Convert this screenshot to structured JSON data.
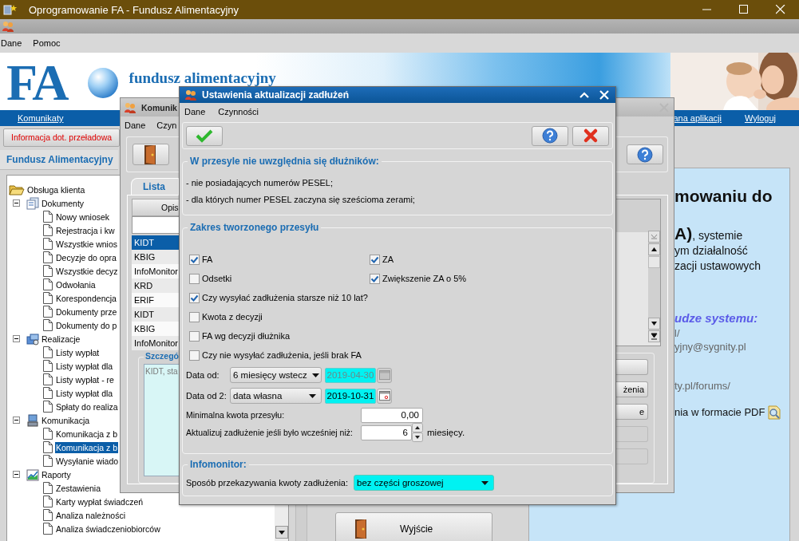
{
  "app": {
    "title": "Oprogramowanie FA - Fundusz Alimentacyjny",
    "menu": [
      {
        "label": "Dane"
      },
      {
        "label": "Pomoc"
      }
    ],
    "banner": {
      "logo": "FA",
      "tagline": "fundusz alimentacyjny"
    },
    "nav": [
      {
        "label": "Komunikaty"
      },
      {
        "label": "ana aplikacji"
      },
      {
        "label": "Wyloguj"
      }
    ],
    "info_button": "Informacja dot. przeładowa",
    "panel_title": "Fundusz Alimentacyjny",
    "tree": [
      {
        "label": "Obsługa klienta",
        "kind": "folder",
        "expanded": true,
        "selected": false,
        "children": [
          {
            "label": "Dokumenty",
            "kind": "documents",
            "expanded": true,
            "selected": false,
            "children": [
              {
                "label": "Nowy wniosek",
                "selected": false
              },
              {
                "label": "Rejestracja i kw",
                "selected": false
              },
              {
                "label": "Wszystkie wnios",
                "selected": false
              },
              {
                "label": "Decyzje do opra",
                "selected": false
              },
              {
                "label": "Wszystkie decyz",
                "selected": false
              },
              {
                "label": "Odwołania",
                "selected": false
              },
              {
                "label": "Korespondencja",
                "selected": false
              },
              {
                "label": "Dokumenty prze",
                "selected": false
              },
              {
                "label": "Dokumenty do p",
                "selected": false
              }
            ]
          },
          {
            "label": "Realizacje",
            "kind": "payments",
            "expanded": true,
            "selected": false,
            "children": [
              {
                "label": "Listy wypłat",
                "selected": false
              },
              {
                "label": "Listy wypłat dla",
                "selected": false
              },
              {
                "label": "Listy wypłat - re",
                "selected": false
              },
              {
                "label": "Listy wypłat dla",
                "selected": false
              },
              {
                "label": "Spłaty do realiza",
                "selected": false
              }
            ]
          },
          {
            "label": "Komunikacja",
            "kind": "communication",
            "expanded": true,
            "selected": false,
            "children": [
              {
                "label": "Komunikacja z b",
                "selected": false
              },
              {
                "label": "Komunikacja z b",
                "selected": true
              },
              {
                "label": "Wysyłanie wiado",
                "selected": false
              }
            ]
          },
          {
            "label": "Raporty",
            "kind": "reports",
            "expanded": true,
            "selected": false,
            "children": [
              {
                "label": "Zestawienia",
                "selected": false
              },
              {
                "label": "Karty wypłat świadczeń",
                "selected": false
              },
              {
                "label": "Analiza należności",
                "selected": false
              },
              {
                "label": "Analiza świadczeniobiorców",
                "selected": false
              }
            ]
          }
        ]
      }
    ],
    "welcome": [
      {
        "kind": "heading",
        "lines": [
          "mowaniu do"
        ]
      },
      {
        "kind": "intro",
        "lines": [
          "**A)**, systemie",
          "ym działalność",
          "zacji ustawowych"
        ]
      },
      {
        "kind": "subheading",
        "lines": [
          "udze systemu:"
        ]
      },
      {
        "kind": "contact",
        "lines": [
          "l/",
          "yjny@sygnity.pl"
        ]
      },
      {
        "kind": "contact",
        "lines": [
          "ty.pl/forums/"
        ]
      },
      {
        "kind": "pdf",
        "lines": [
          "nia w formacie PDF"
        ]
      }
    ],
    "exit_button": "Wyjście"
  },
  "comm_window": {
    "title": "Komunik",
    "menu": [
      {
        "label": "Dane"
      },
      {
        "label": "Czyn"
      }
    ],
    "tab": {
      "label": "Lista",
      "selected": true
    },
    "column": "Opis",
    "rows": [
      {
        "text": "KIDT",
        "selected": true
      },
      {
        "text": "KBIG",
        "selected": false
      },
      {
        "text": "InfoMonitor",
        "selected": false
      },
      {
        "text": "KRD",
        "selected": false
      },
      {
        "text": "ERIF",
        "selected": false
      },
      {
        "text": "KIDT",
        "selected": false
      },
      {
        "text": "KBIG",
        "selected": false
      },
      {
        "text": "InfoMonitor",
        "selected": false
      }
    ],
    "details_legend": "Szczegó",
    "details_text": "KIDT, sta",
    "side_buttons": [
      {
        "disabled": false
      },
      {
        "label": "żenia",
        "disabled": false
      },
      {
        "label": "e",
        "disabled": false
      },
      {
        "disabled": true
      },
      {
        "disabled": true
      }
    ]
  },
  "dialog": {
    "title": "Ustawienia aktualizacji zadłużeń",
    "menu": [
      {
        "label": "Dane"
      },
      {
        "label": "Czynności"
      }
    ],
    "exclusions": {
      "legend": "W przesyle nie uwzględnia się dłużników:",
      "lines": [
        "- nie posiadających numerów PESEL;",
        "- dla których numer PESEL zaczyna się sześcioma zerami;"
      ]
    },
    "scope": {
      "legend": "Zakres tworzonego przesyłu",
      "grid": [
        {
          "label": "FA",
          "checked": true
        },
        {
          "label": "ZA",
          "checked": true
        },
        {
          "label": "Odsetki",
          "checked": false
        },
        {
          "label": "Zwiększenie ZA o 5%",
          "checked": true
        }
      ],
      "options": [
        {
          "label": "Czy wysyłać zadłużenia starsze niż 10 lat?",
          "checked": true
        },
        {
          "label": "Kwota z decyzji",
          "checked": false
        },
        {
          "label": "FA wg decyzji dłużnika",
          "checked": false
        },
        {
          "label": "Czy nie wysyłać zadłużenia, jeśli brak FA",
          "checked": false
        }
      ],
      "dates": [
        {
          "label": "Data od:",
          "mode": "6 miesięcy wstecz",
          "date": "2019-04-30",
          "disabled": true
        },
        {
          "label": "Data od 2:",
          "mode": "data własna",
          "date": "2019-10-31",
          "disabled": false
        }
      ],
      "min_amount": {
        "label": "Minimalna kwota przesyłu:",
        "value": "0,00"
      },
      "update_after": {
        "label": "Aktualizuj zadłużenie jeśli było wcześniej niż:",
        "value": "6",
        "unit": "miesięcy."
      }
    },
    "infomonitor": {
      "legend": "Infomonitor:",
      "label": "Sposób przekazywania kwoty zadłużenia:",
      "value": "bez części groszowej"
    }
  }
}
